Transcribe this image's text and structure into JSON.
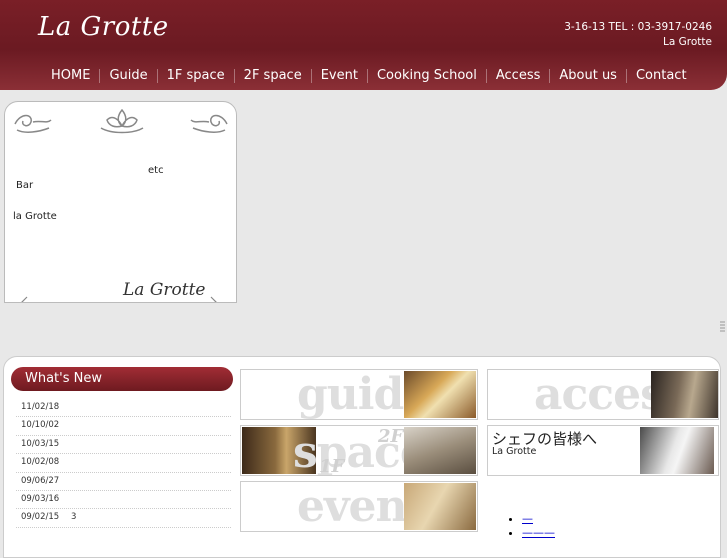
{
  "header": {
    "logo": "La Grotte",
    "address": "3-16-13 TEL : 03-3917-0246",
    "name": "La Grotte"
  },
  "nav": {
    "items": [
      "HOME",
      "Guide",
      "1F space",
      "2F space",
      "Event",
      "Cooking School",
      "Access",
      "About us",
      "Contact"
    ]
  },
  "intro": {
    "etc": "etc",
    "bar": "Bar",
    "name": "la Grotte",
    "logo": "La Grotte"
  },
  "whats_new": {
    "title": "What's New",
    "items": [
      {
        "date": "11/02/18",
        "text": ""
      },
      {
        "date": "10/10/02",
        "text": ""
      },
      {
        "date": "10/03/15",
        "text": ""
      },
      {
        "date": "10/02/08",
        "text": ""
      },
      {
        "date": "09/06/27",
        "text": ""
      },
      {
        "date": "09/03/16",
        "text": ""
      },
      {
        "date": "09/02/15",
        "text": "3"
      }
    ]
  },
  "panels": {
    "guide": "guide",
    "space": "space",
    "space_1f": "1F",
    "space_2f": "2F",
    "event": "event",
    "access": "access",
    "chef_title": "シェフの皆様へ",
    "chef_sub": "La Grotte"
  },
  "links": [
    "—",
    "———"
  ]
}
